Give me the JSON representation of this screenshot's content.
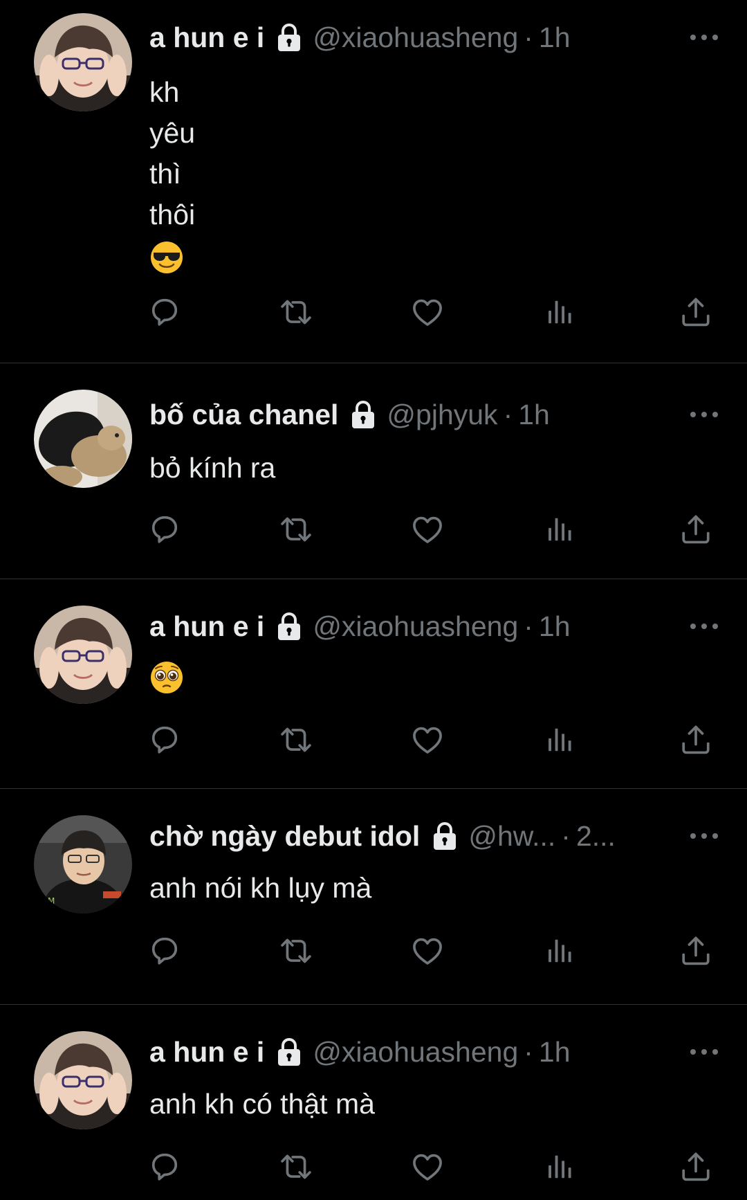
{
  "colors": {
    "background": "#000000",
    "text_primary": "#e7e9ea",
    "text_secondary": "#71767b",
    "divider": "#2f3336"
  },
  "tweets": [
    {
      "display_name": "a hun e i",
      "handle": "@xiaohuasheng",
      "separator": "·",
      "time": "1h",
      "lines": [
        "kh",
        "yêu",
        "thì",
        "thôi"
      ],
      "emoji": "smiling-face-with-sunglasses",
      "avatar": "avatar-boy-glasses"
    },
    {
      "display_name": "bố của chanel",
      "handle": "@pjhyuk",
      "separator": "·",
      "time": "1h",
      "lines": [
        "bỏ kính ra"
      ],
      "avatar": "avatar-plush-bear"
    },
    {
      "display_name": "a hun e i",
      "handle": "@xiaohuasheng",
      "separator": "·",
      "time": "1h",
      "lines": [],
      "emoji": "pleading-face",
      "avatar": "avatar-boy-glasses"
    },
    {
      "display_name": "chờ ngày debut idol",
      "handle": "@hw...",
      "separator": "·",
      "time": "2...",
      "lines": [
        "anh nói kh lụy mà"
      ],
      "avatar": "avatar-gamer"
    },
    {
      "display_name": "a hun e i",
      "handle": "@xiaohuasheng",
      "separator": "·",
      "time": "1h",
      "lines": [
        "anh kh có thật mà"
      ],
      "avatar": "avatar-boy-glasses"
    }
  ],
  "icons": {
    "lock": "lock-icon",
    "more": "more-icon",
    "reply": "reply-icon",
    "retweet": "retweet-icon",
    "like": "like-icon",
    "views": "views-icon",
    "share": "share-icon"
  }
}
